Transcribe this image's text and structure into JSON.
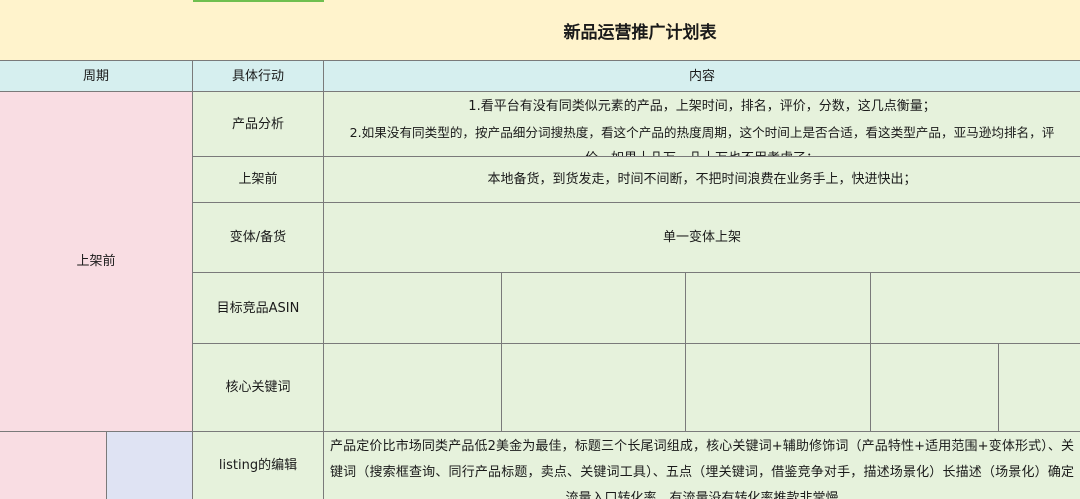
{
  "title": "新品运营推广计划表",
  "header": {
    "period": "周期",
    "action": "具体行动",
    "content": "内容"
  },
  "section_label": "上架前",
  "rows": {
    "product_analysis": {
      "action": "产品分析",
      "lines": [
        "1.看平台有没有同类似元素的产品，上架时间，排名，评价，分数，这几点衡量；",
        "2.如果没有同类型的，按产品细分词搜热度，看这个产品的热度周期，这个时间上是否合适，看这类型产品，亚马逊均排名，评",
        "价，如果十几万，几十万也不用考虑了；"
      ]
    },
    "pre_listing": {
      "action": "上架前",
      "content": "本地备货，到货发走，时间不间断，不把时间浪费在业务手上，快进快出；"
    },
    "variant": {
      "action": "变体/备货",
      "content": "单一变体上架"
    },
    "asin": {
      "action": "目标竞品ASIN"
    },
    "keywords": {
      "action": "核心关键词"
    },
    "listing": {
      "action": "listing的编辑",
      "content": "产品定价比市场同类产品低2美金为最佳，标题三个长尾词组成，核心关键词+辅助修饰词（产品特性+适用范围+变体形式）、关键词（搜索框查询、同行产品标题，卖点、关键词工具）、五点（埋关键词，借鉴竞争对手，描述场景化）长描述（场景化）确定流量入口转化率，有流量没有转化率推款非常慢"
    }
  },
  "colors": {
    "title_bg": "#fff3cc",
    "header_bg": "#d6efef",
    "period_bg": "#f9dde3",
    "body_bg": "#e6f2dc",
    "lavender": "#dfe3f3"
  }
}
